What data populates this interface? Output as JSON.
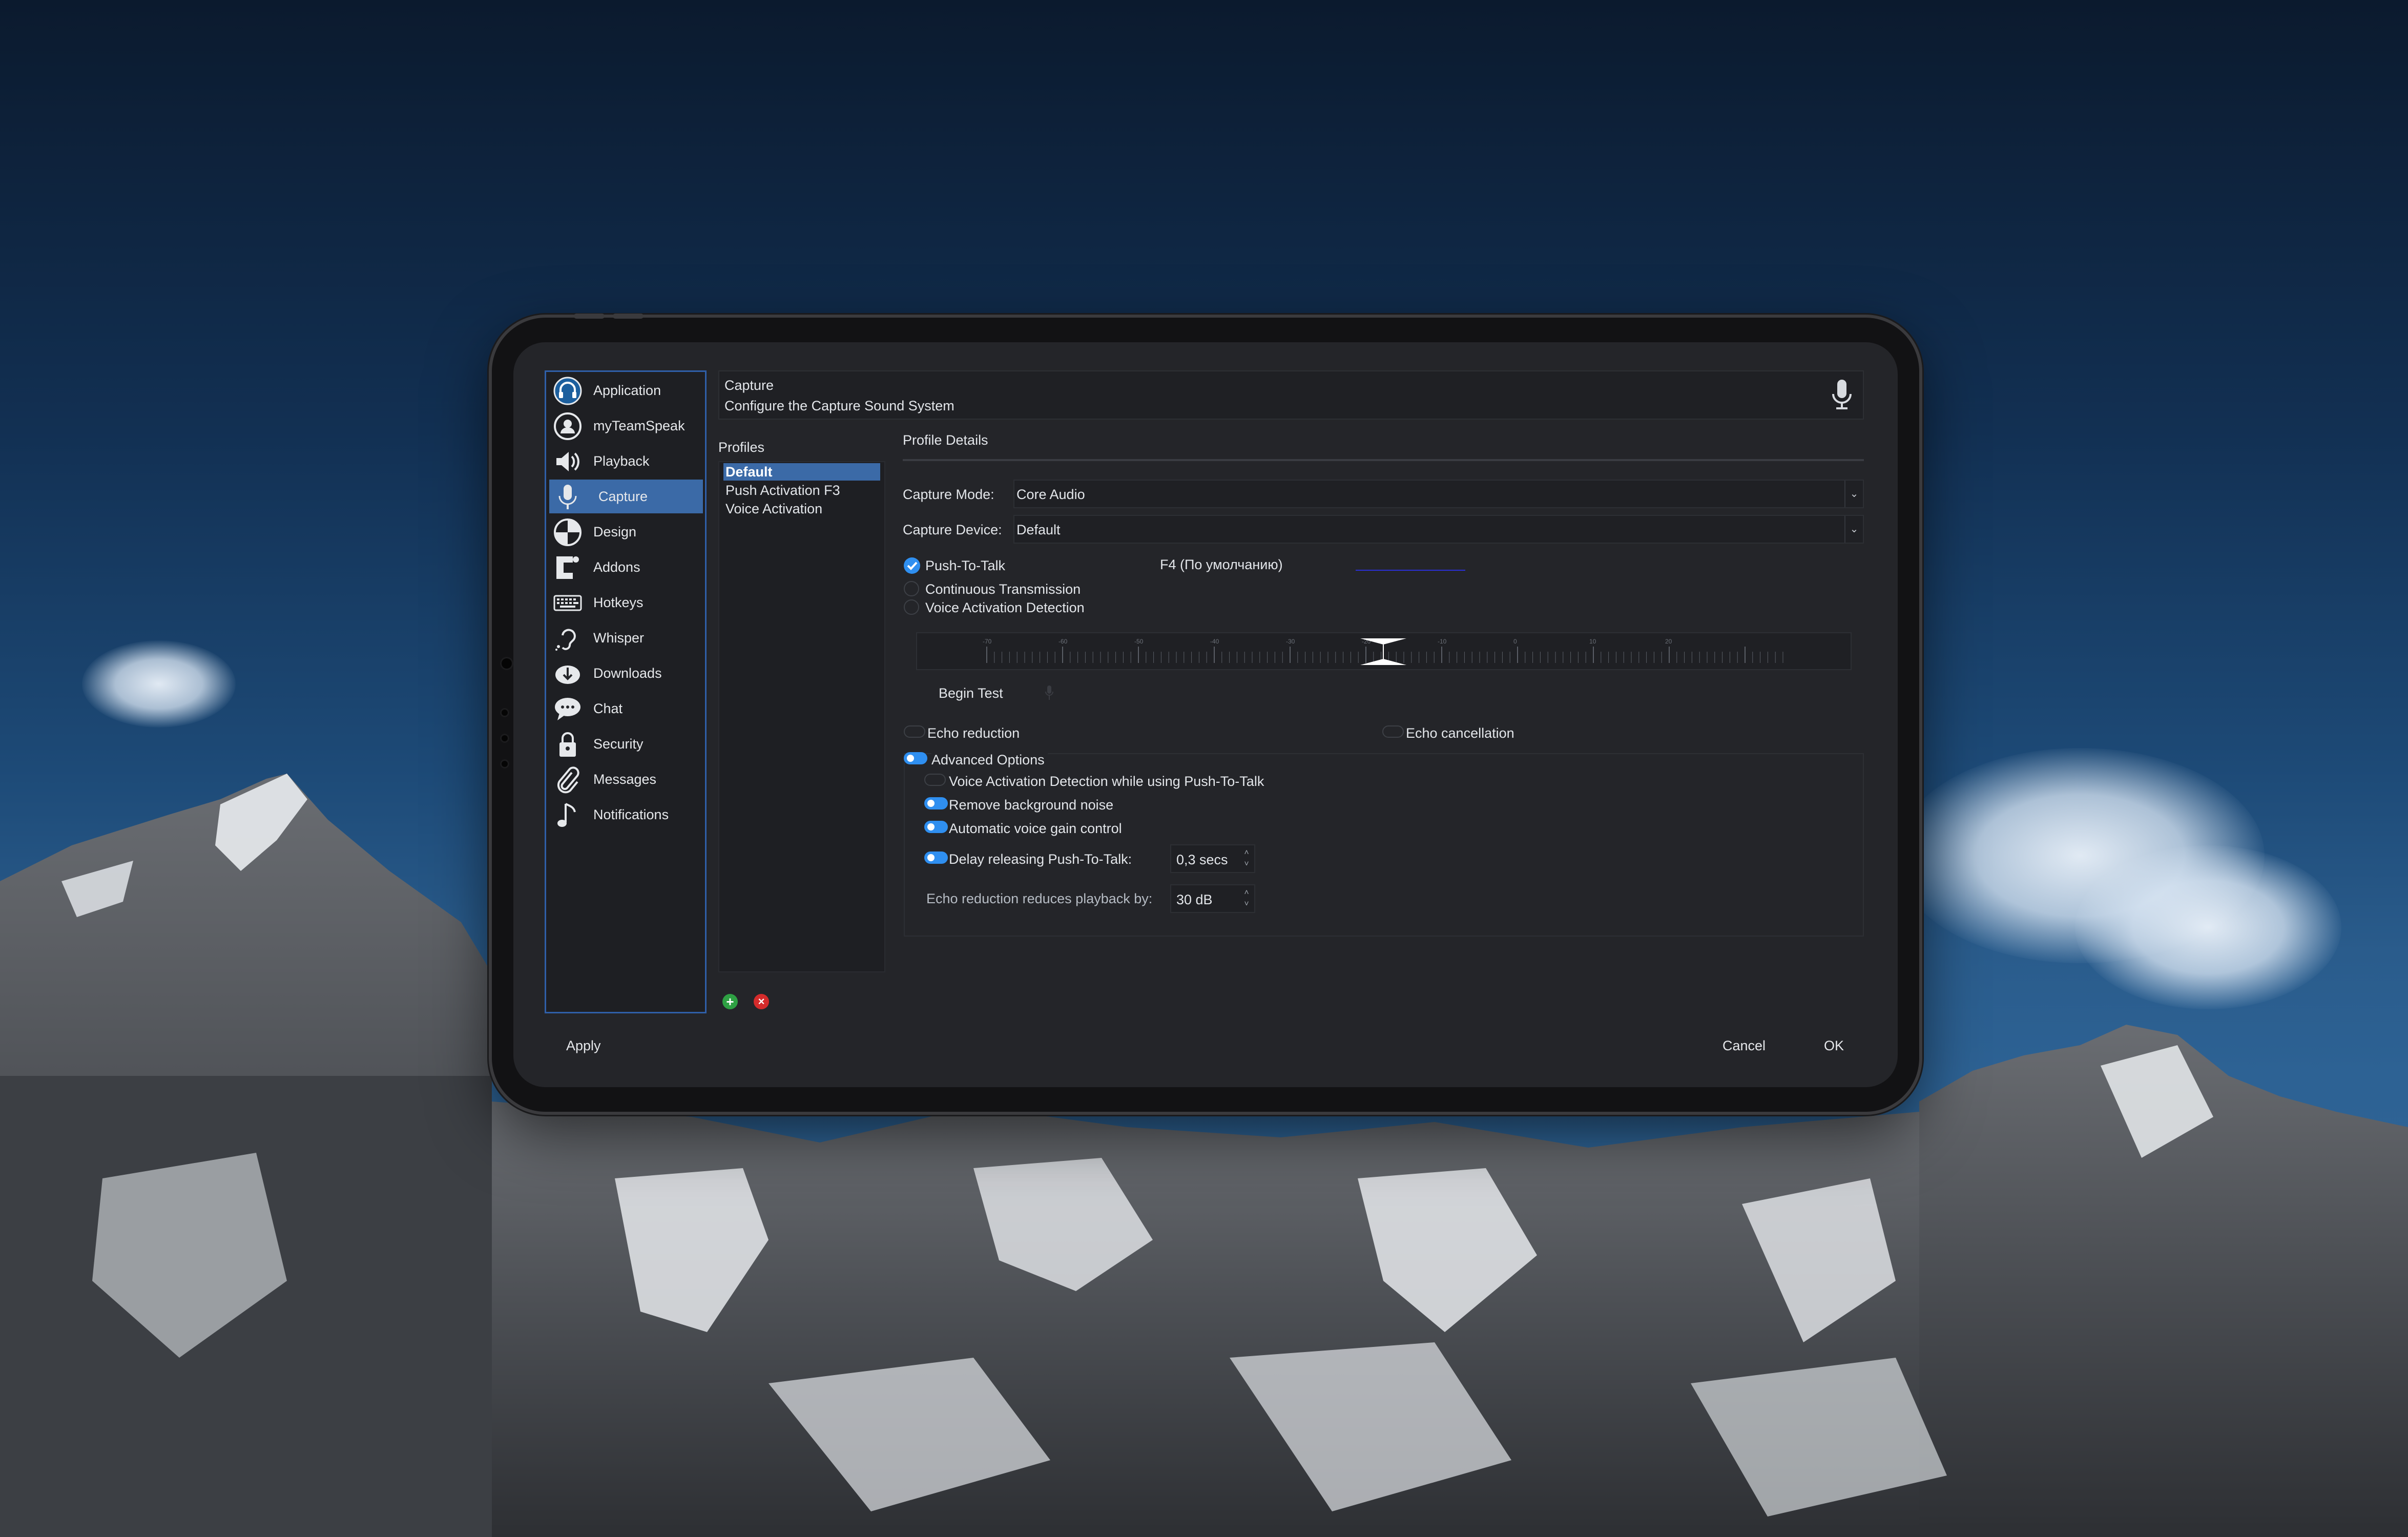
{
  "sidebar": {
    "items": [
      {
        "label": "Application",
        "icon": "headset-icon"
      },
      {
        "label": "myTeamSpeak",
        "icon": "user-icon"
      },
      {
        "label": "Playback",
        "icon": "speaker-icon"
      },
      {
        "label": "Capture",
        "icon": "microphone-icon"
      },
      {
        "label": "Design",
        "icon": "design-icon"
      },
      {
        "label": "Addons",
        "icon": "puzzle-icon"
      },
      {
        "label": "Hotkeys",
        "icon": "keyboard-icon"
      },
      {
        "label": "Whisper",
        "icon": "ear-icon"
      },
      {
        "label": "Downloads",
        "icon": "download-icon"
      },
      {
        "label": "Chat",
        "icon": "chat-icon"
      },
      {
        "label": "Security",
        "icon": "lock-icon"
      },
      {
        "label": "Messages",
        "icon": "paperclip-icon"
      },
      {
        "label": "Notifications",
        "icon": "music-note-icon"
      }
    ],
    "active_index": 3
  },
  "header": {
    "title": "Capture",
    "subtitle": "Configure the Capture Sound System",
    "icon": "microphone-icon"
  },
  "profiles": {
    "title": "Profiles",
    "items": [
      "Default",
      "Push Activation F3",
      "Voice Activation"
    ],
    "active_index": 0,
    "add_icon": "plus-circle-icon",
    "remove_icon": "x-circle-icon"
  },
  "details": {
    "title": "Profile Details",
    "capture_mode_label": "Capture Mode:",
    "capture_mode_value": "Core Audio",
    "capture_device_label": "Capture Device:",
    "capture_device_value": "Default",
    "push_to_talk_label": "Push-To-Talk",
    "push_to_talk_checked": true,
    "hotkey_value": "F4 (По умолчанию)",
    "continuous_label": "Continuous Transmission",
    "vad_label": "Voice Activation Detection",
    "meter_ticks": [
      "-70",
      "-60",
      "-50",
      "-40",
      "-30",
      "-20",
      "-10",
      "0",
      "10",
      "20"
    ],
    "begin_test_label": "Begin Test",
    "echo_reduction_label": "Echo reduction",
    "echo_cancellation_label": "Echo cancellation",
    "advanced_options_label": "Advanced Options",
    "advanced_options_on": true,
    "vad_while_ptt_label": "Voice Activation Detection while using Push-To-Talk",
    "remove_noise_label": "Remove background noise",
    "agc_label": "Automatic voice gain control",
    "delay_ptt_label": "Delay releasing Push-To-Talk:",
    "delay_ptt_value": "0,3 secs",
    "echo_playback_label": "Echo reduction reduces playback by:",
    "echo_playback_value": "30 dB"
  },
  "footer": {
    "apply_label": "Apply",
    "cancel_label": "Cancel",
    "ok_label": "OK"
  },
  "colors": {
    "accent": "#2f8ff0",
    "selection": "#3b6aa7",
    "panel": "#242529",
    "text": "#e3e6ea"
  }
}
